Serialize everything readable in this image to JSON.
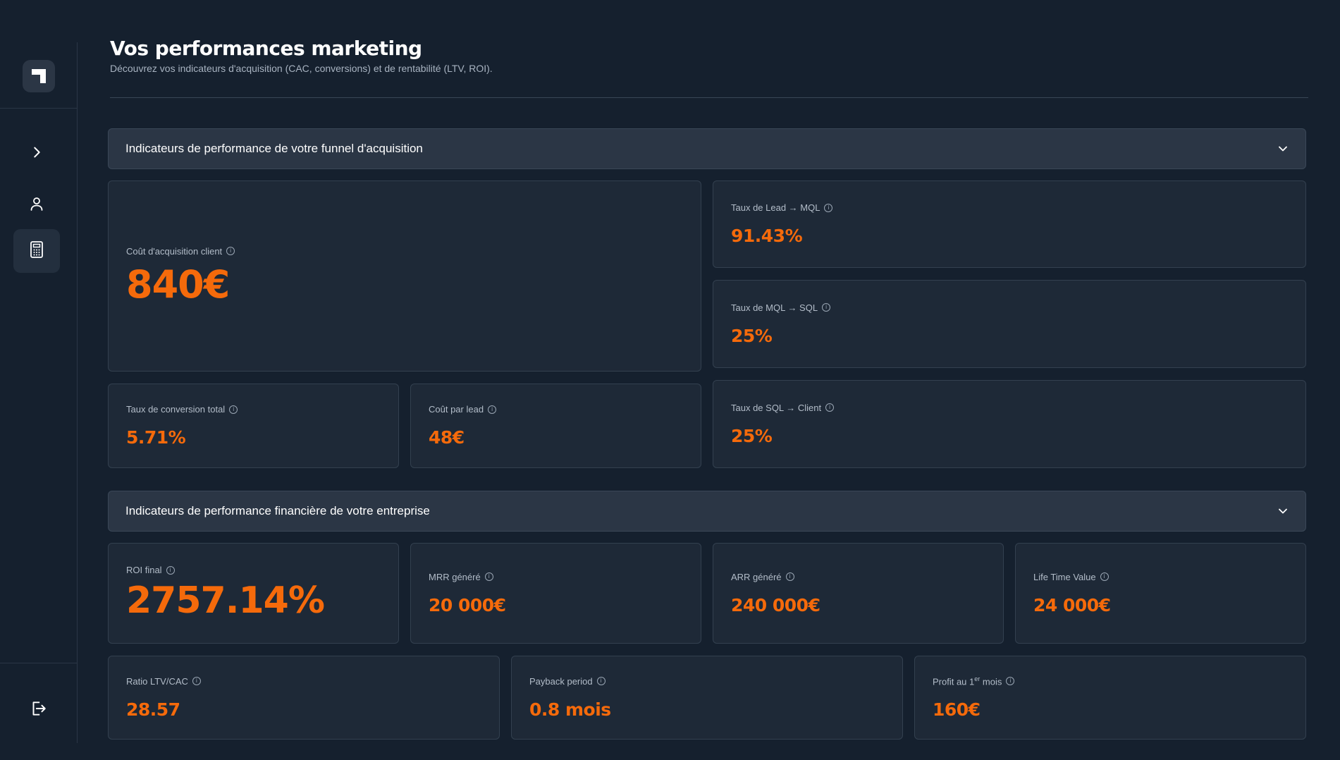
{
  "header": {
    "title": "Vos performances marketing",
    "subtitle": "Découvrez vos indicateurs d'acquisition (CAC, conversions) et de rentabilité (LTV, ROI)."
  },
  "sections": {
    "funnel_title": "Indicateurs de performance de votre funnel d'acquisition",
    "finance_title": "Indicateurs de performance financière de votre entreprise"
  },
  "funnel": {
    "cac": {
      "label": "Coût d'acquisition client",
      "value": "840€"
    },
    "lead_mql": {
      "label": "Taux de Lead → MQL",
      "value": "91.43%"
    },
    "mql_sql": {
      "label": "Taux de MQL → SQL",
      "value": "25%"
    },
    "sql_client": {
      "label": "Taux de SQL → Client",
      "value": "25%"
    },
    "total_conversion": {
      "label": "Taux de conversion total",
      "value": "5.71%"
    },
    "cost_per_lead": {
      "label": "Coût par lead",
      "value": "48€"
    }
  },
  "finance": {
    "roi": {
      "label": "ROI final",
      "value": "2757.14%"
    },
    "mrr": {
      "label": "MRR généré",
      "value": "20 000€"
    },
    "arr": {
      "label": "ARR généré",
      "value": "240 000€"
    },
    "ltv": {
      "label": "Life Time Value",
      "value": "24 000€"
    },
    "ratio": {
      "label": "Ratio LTV/CAC",
      "value": "28.57"
    },
    "payback": {
      "label": "Payback period",
      "value": "0.8 mois"
    },
    "profit": {
      "label_pre": "Profit au 1",
      "label_sup": "er",
      "label_post": " mois",
      "value": "160€"
    }
  },
  "icons": {
    "logo": "brand-logo-icon",
    "expand": "chevron-right-icon",
    "user": "user-icon",
    "calculator": "calculator-icon",
    "logout": "logout-icon",
    "info": "info-icon",
    "collapse": "chevron-down-icon"
  },
  "colors": {
    "accent": "#f56a0b",
    "background": "#15202e",
    "card": "#1e2937",
    "section_header": "#2b3645"
  }
}
